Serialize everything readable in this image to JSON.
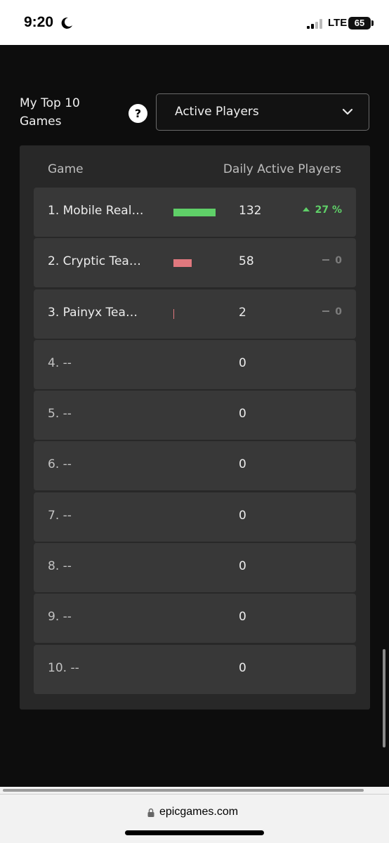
{
  "status_bar": {
    "time": "9:20",
    "network": "LTE",
    "battery": "65"
  },
  "section": {
    "title": "My Top 10 Games",
    "help": "?",
    "metric_select": "Active Players"
  },
  "table": {
    "header_game": "Game",
    "header_metric": "Daily Active Players",
    "bar_max": 132,
    "rows": [
      {
        "name": "1. Mobile Reali…",
        "value": "132",
        "bar": 132,
        "bar_color": "#5fd068",
        "change": "27 %",
        "trend": "up"
      },
      {
        "name": "2. Cryptic Tea…",
        "value": "58",
        "bar": 58,
        "bar_color": "#e0787e",
        "change": "0",
        "trend": "flat"
      },
      {
        "name": "3. Painyx Team…",
        "value": "2",
        "bar": 2,
        "bar_color": "#e0787e",
        "change": "0",
        "trend": "flat"
      },
      {
        "name": "4. --",
        "value": "0",
        "bar": 0,
        "bar_color": "",
        "change": "",
        "trend": "none"
      },
      {
        "name": "5. --",
        "value": "0",
        "bar": 0,
        "bar_color": "",
        "change": "",
        "trend": "none"
      },
      {
        "name": "6. --",
        "value": "0",
        "bar": 0,
        "bar_color": "",
        "change": "",
        "trend": "none"
      },
      {
        "name": "7. --",
        "value": "0",
        "bar": 0,
        "bar_color": "",
        "change": "",
        "trend": "none"
      },
      {
        "name": "8. --",
        "value": "0",
        "bar": 0,
        "bar_color": "",
        "change": "",
        "trend": "none"
      },
      {
        "name": "9. --",
        "value": "0",
        "bar": 0,
        "bar_color": "",
        "change": "",
        "trend": "none"
      },
      {
        "name": "10. --",
        "value": "0",
        "bar": 0,
        "bar_color": "",
        "change": "",
        "trend": "none"
      }
    ]
  },
  "browser": {
    "url": "epicgames.com"
  }
}
